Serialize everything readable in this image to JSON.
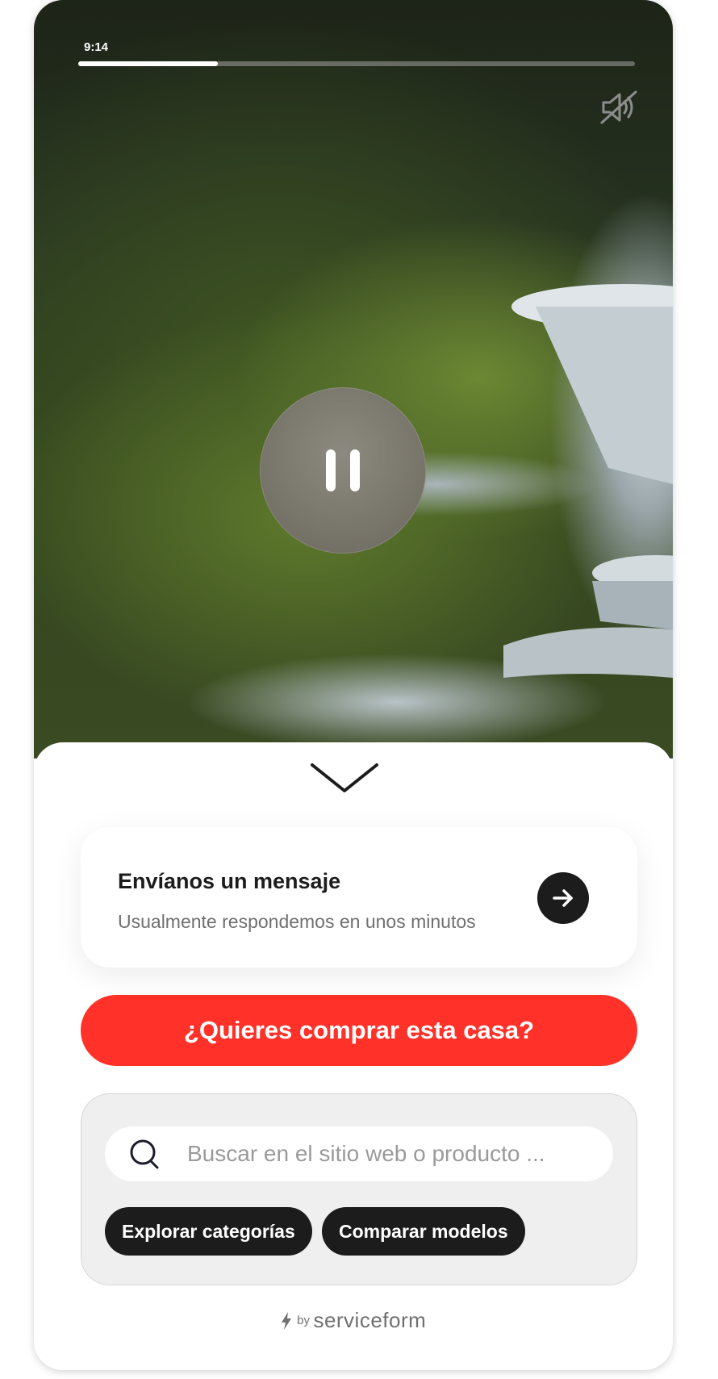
{
  "video": {
    "time": "9:14",
    "progress": 0.25,
    "muted": true,
    "playing": true
  },
  "message_card": {
    "title": "Envíanos un mensaje",
    "subtitle": "Usualmente respondemos en unos minutos"
  },
  "cta": {
    "label": "¿Quieres comprar esta casa?",
    "color": "#ff3129"
  },
  "search": {
    "placeholder": "Buscar en el sitio web o producto ..."
  },
  "chips": [
    {
      "label": "Explorar categorías"
    },
    {
      "label": "Comparar modelos"
    }
  ],
  "footer": {
    "by": "by",
    "brand": "serviceform"
  },
  "icons": {
    "mute": "speaker-muted-icon",
    "pause": "pause-icon",
    "collapse": "chevron-down-icon",
    "send": "arrow-right-icon",
    "search": "search-icon",
    "brand": "bolt-icon"
  }
}
